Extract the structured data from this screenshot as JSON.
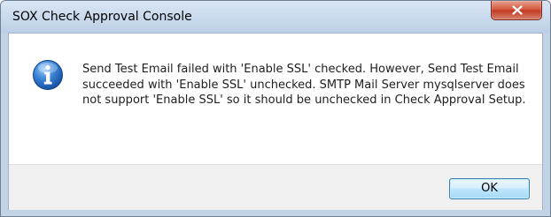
{
  "window": {
    "title": "SOX Check Approval Console"
  },
  "dialog": {
    "icon": "information-icon",
    "message": "Send Test Email failed with 'Enable SSL' checked. However, Send Test Email succeeded with 'Enable SSL' unchecked. SMTP Mail Server mysqlserver does not support 'Enable SSL' so it should be unchecked in Check Approval Setup.",
    "ok_label": "OK"
  },
  "colors": {
    "close_button": "#c23a22",
    "info_icon_blue": "#2a6fc4",
    "frame": "#c3d3e6"
  }
}
